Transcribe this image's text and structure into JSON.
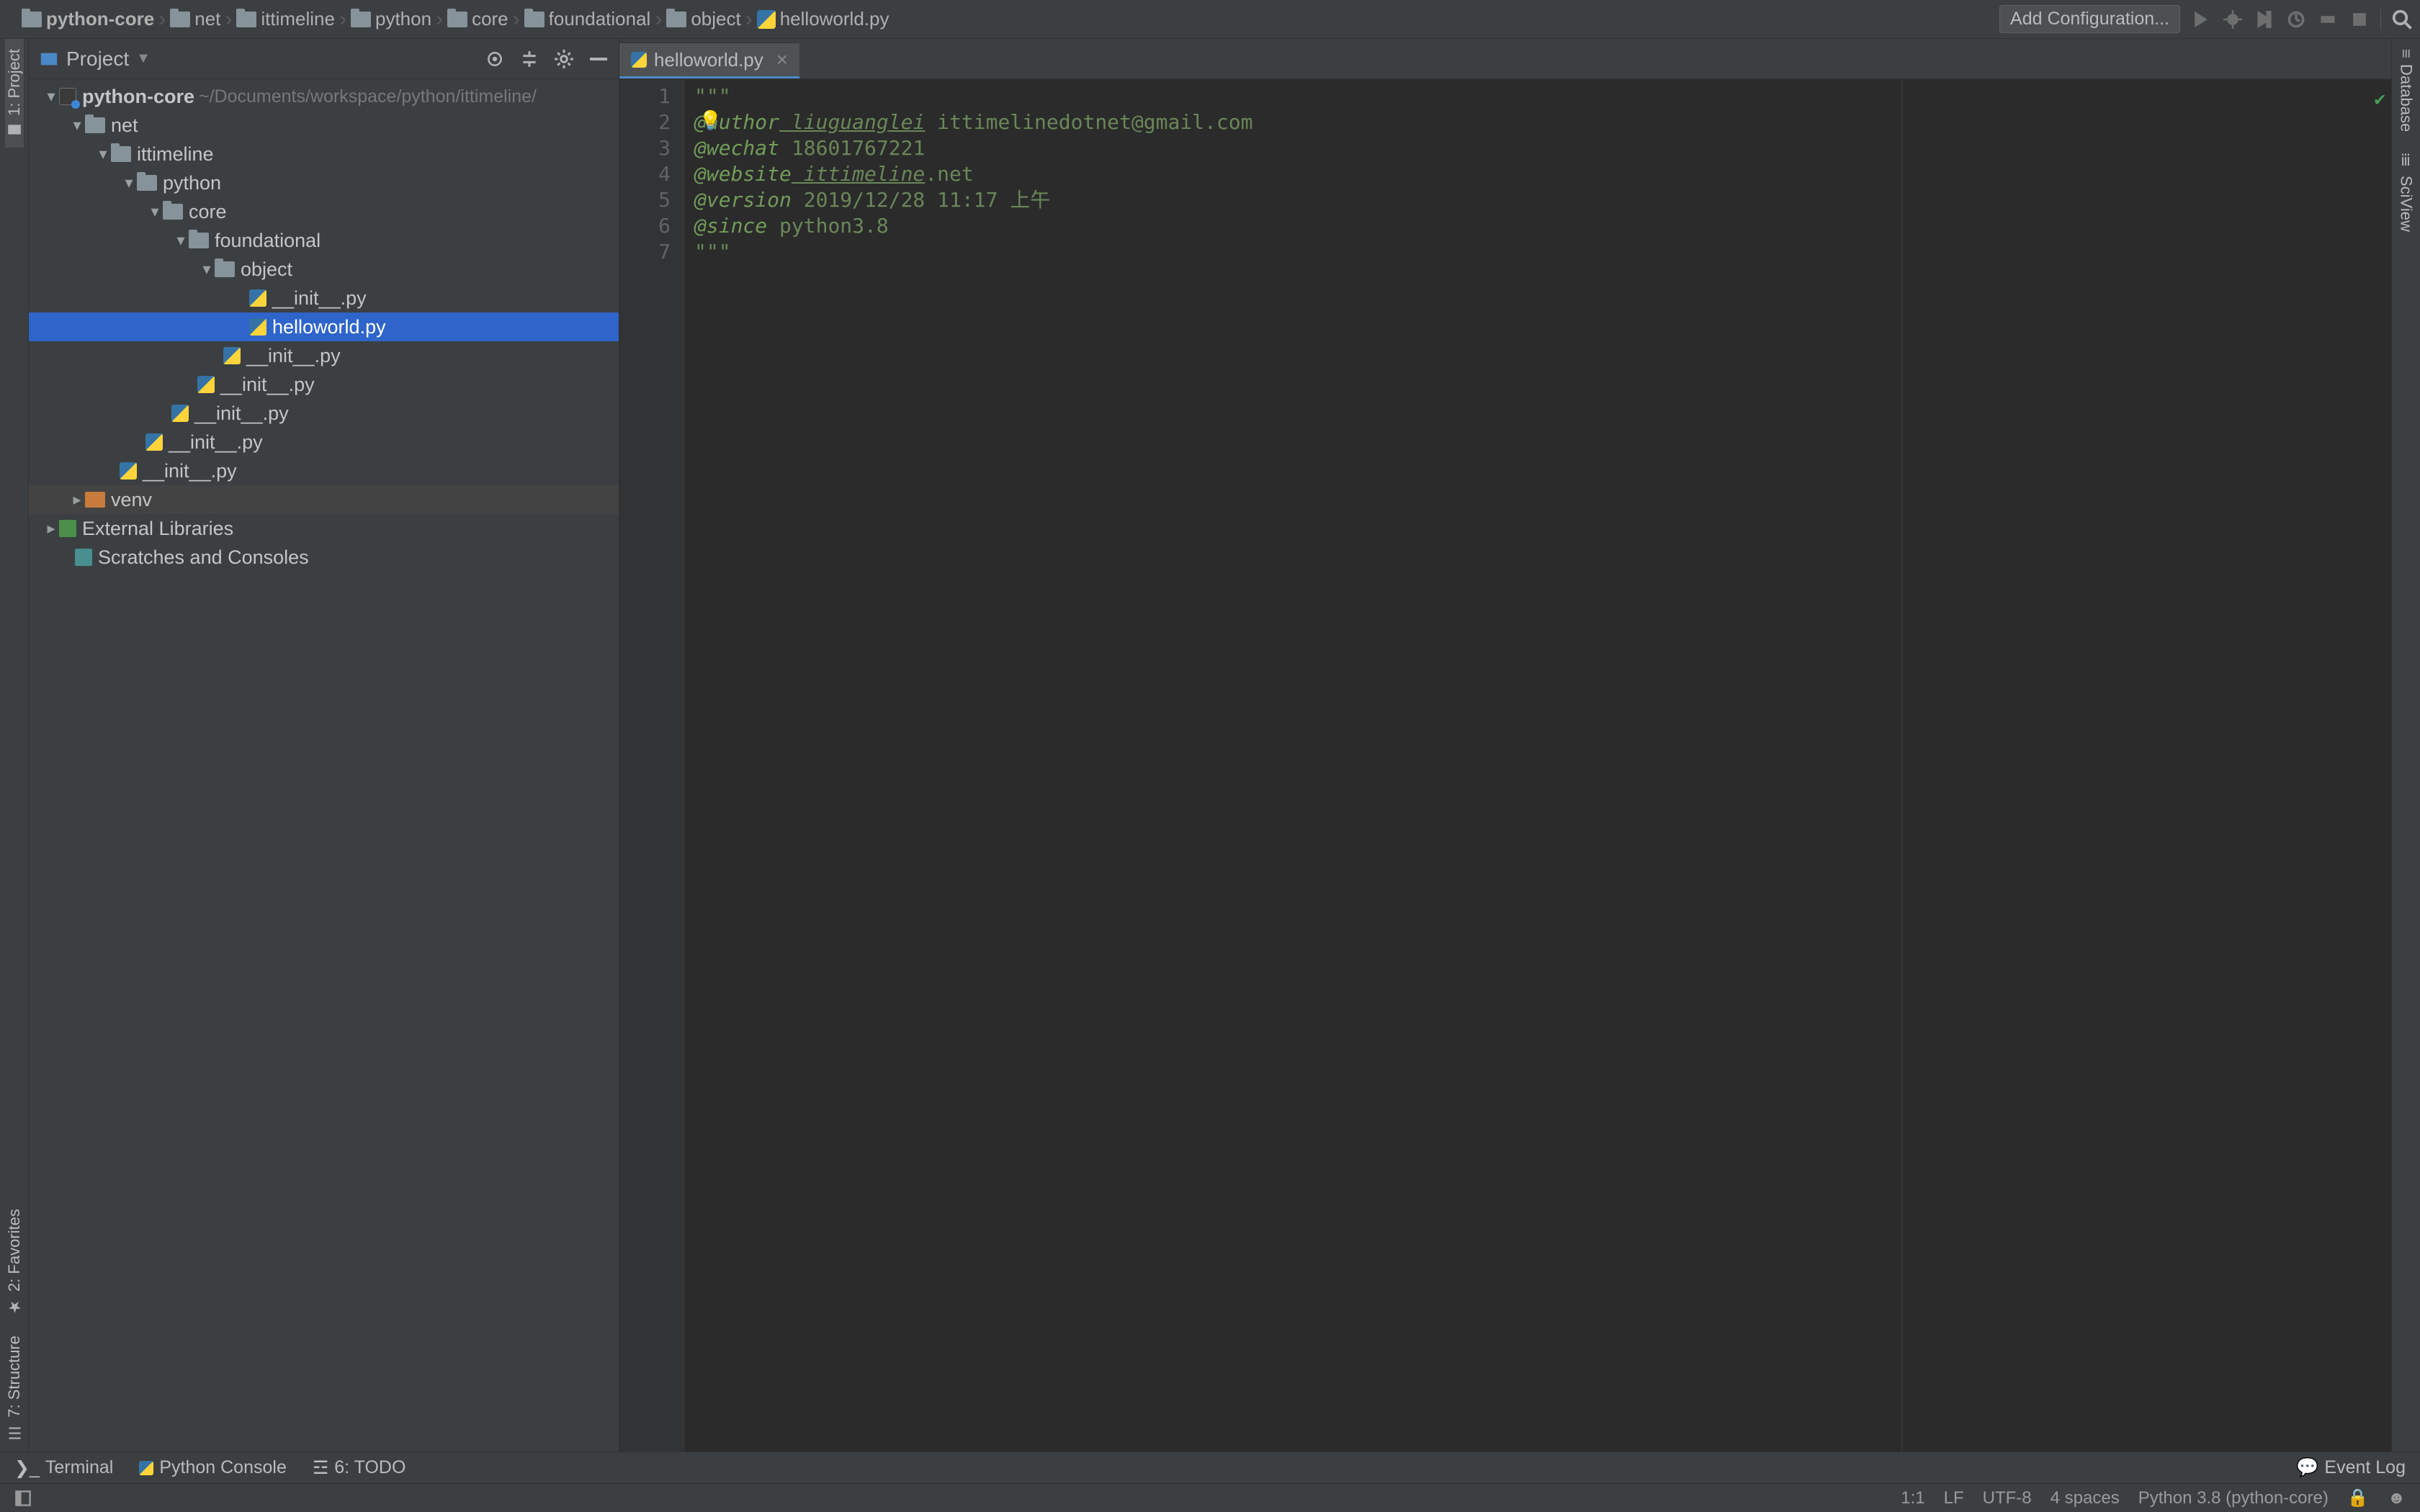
{
  "breadcrumb": [
    "python-core",
    "net",
    "ittimeline",
    "python",
    "core",
    "foundational",
    "object",
    "helloworld.py"
  ],
  "addConfiguration": "Add Configuration...",
  "projectPanel": {
    "title": "Project",
    "rootName": "python-core",
    "rootPath": "~/Documents/workspace/python/ittimeline/",
    "tree": {
      "net": "net",
      "ittimeline": "ittimeline",
      "python": "python",
      "core": "core",
      "foundational": "foundational",
      "object": "object",
      "init": "__init__.py",
      "helloworld": "helloworld.py",
      "venv": "venv",
      "extlib": "External Libraries",
      "scratches": "Scratches and Consoles"
    }
  },
  "tab": {
    "label": "helloworld.py"
  },
  "gutterLines": [
    "1",
    "2",
    "3",
    "4",
    "5",
    "6",
    "7"
  ],
  "code": {
    "l1": "\"\"\"",
    "l2a": "@author",
    "l2b": " liuguanglei",
    "l2c": " ittimelinedotnet@gmail.com",
    "l3a": "@wechat",
    "l3b": " 18601767221",
    "l4a": "@website",
    "l4b": " ittimeline",
    "l4c": ".net",
    "l5a": "@version",
    "l5b": " 2019/12/28 11:17 上午",
    "l6a": "@since",
    "l6b": " python3.8",
    "l7": "\"\"\""
  },
  "leftRail": {
    "project": "1: Project",
    "favorites": "2: Favorites",
    "structure": "7: Structure"
  },
  "rightRail": {
    "database": "Database",
    "sciview": "SciView"
  },
  "bottomTools": {
    "terminal": "Terminal",
    "pyconsole": "Python Console",
    "todo": "6: TODO"
  },
  "eventLog": "Event Log",
  "status": {
    "pos": "1:1",
    "lf": "LF",
    "enc": "UTF-8",
    "indent": "4 spaces",
    "sdk": "Python 3.8 (python-core)"
  }
}
